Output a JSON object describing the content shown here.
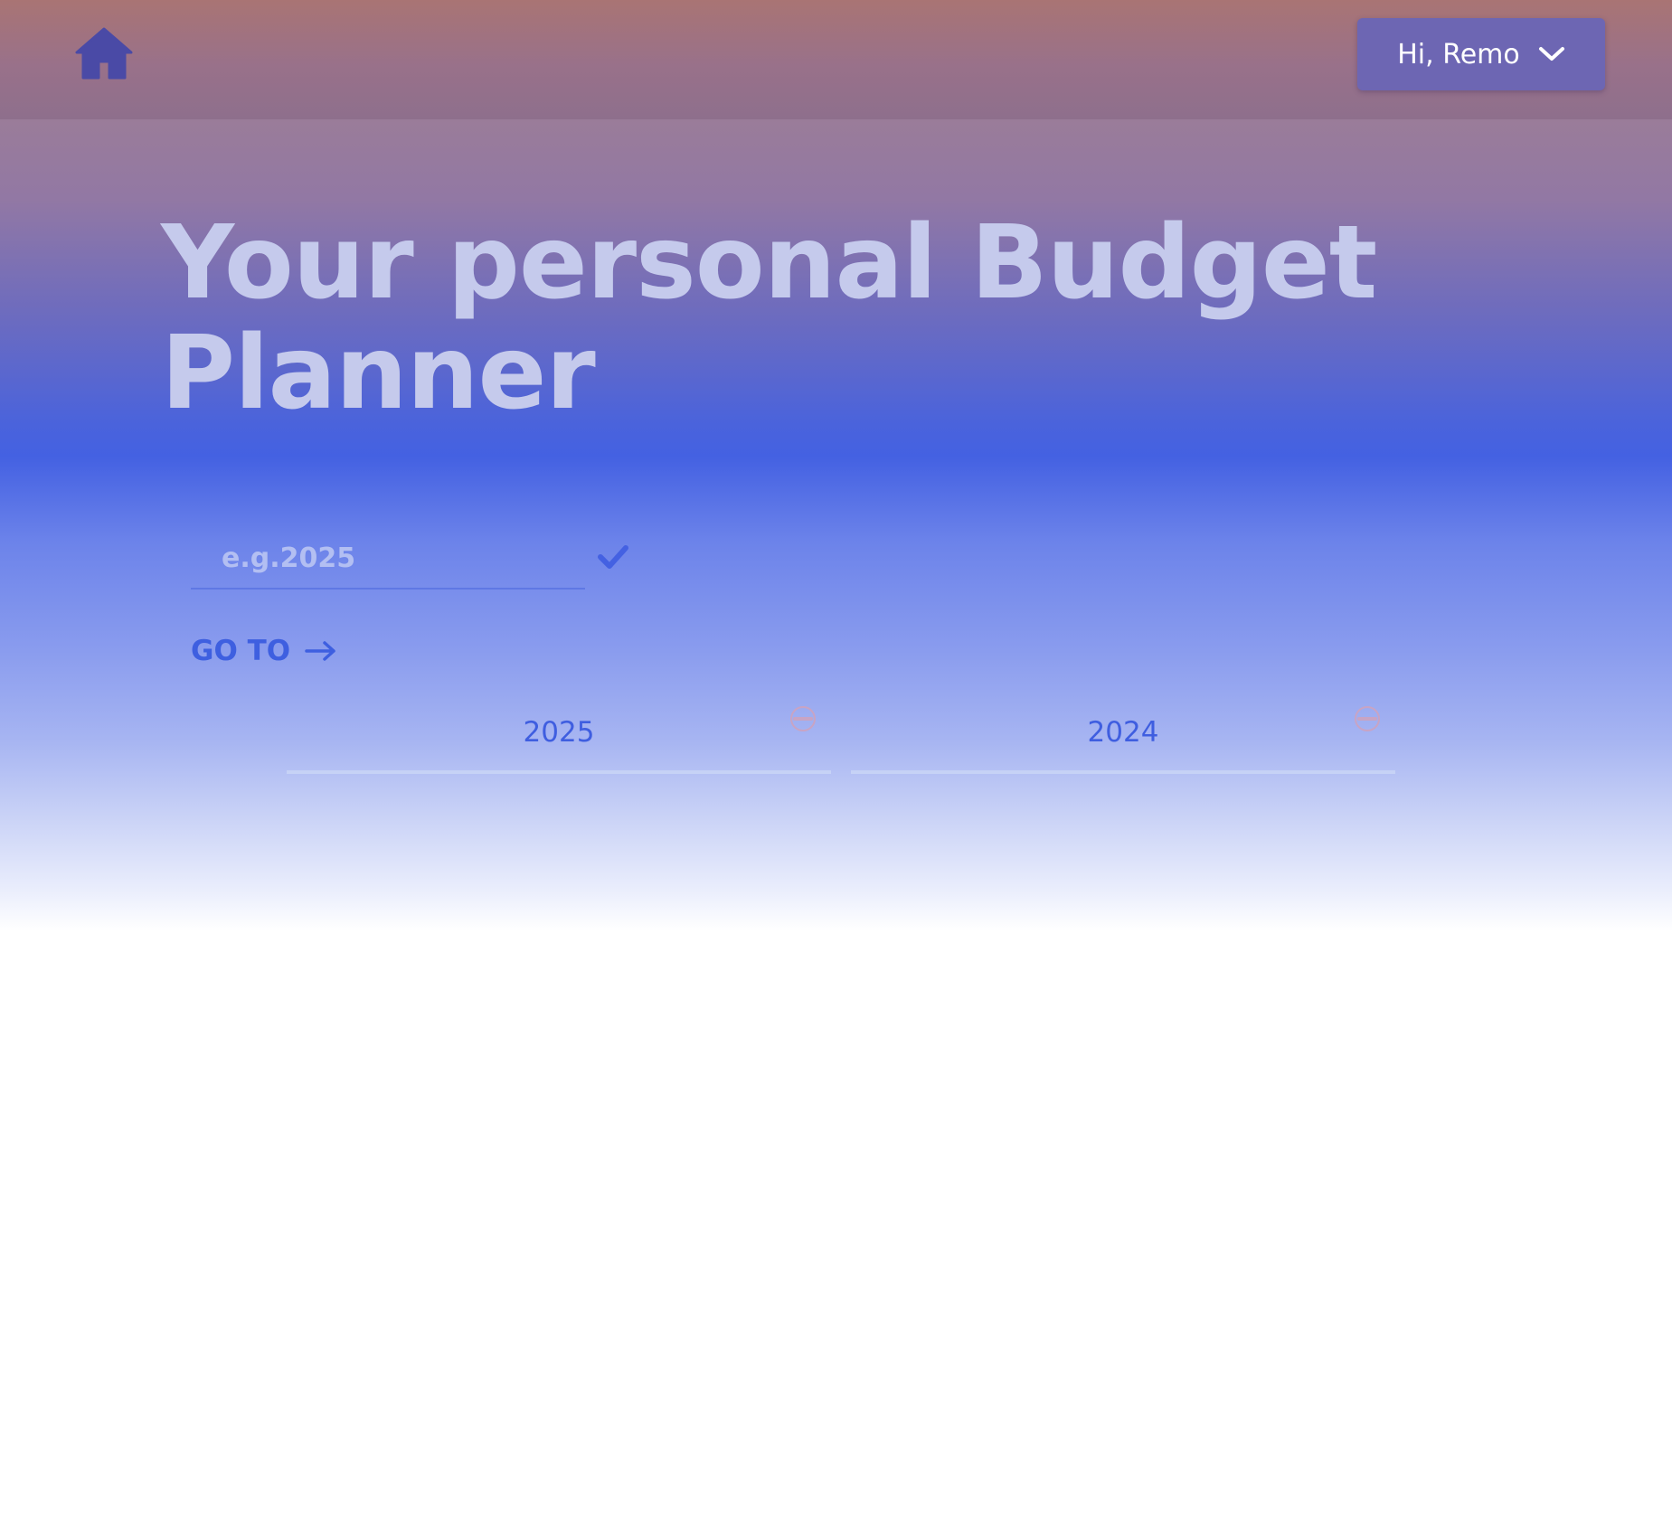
{
  "header": {
    "home_icon": "home-icon",
    "user_menu": {
      "greeting": "Hi, Remo",
      "icon": "chevron-down-icon"
    }
  },
  "hero": {
    "title": "Your personal Budget Planner"
  },
  "year_input": {
    "value": "",
    "placeholder": "e.g.2025",
    "confirm_icon": "check-icon"
  },
  "goto": {
    "label": "GO TO",
    "icon": "arrow-right-icon"
  },
  "year_tabs": [
    {
      "label": "2025",
      "icon": "remove-circle-icon"
    },
    {
      "label": "2024",
      "icon": "remove-circle-icon"
    }
  ],
  "colors": {
    "accent": "#4461e2",
    "title": "#c5caec",
    "user_menu_bg": "#6d66b3",
    "home_icon": "#4a4aa6",
    "tab_underline": "#c6d2f6",
    "remove_icon": "#c8a4c4"
  }
}
